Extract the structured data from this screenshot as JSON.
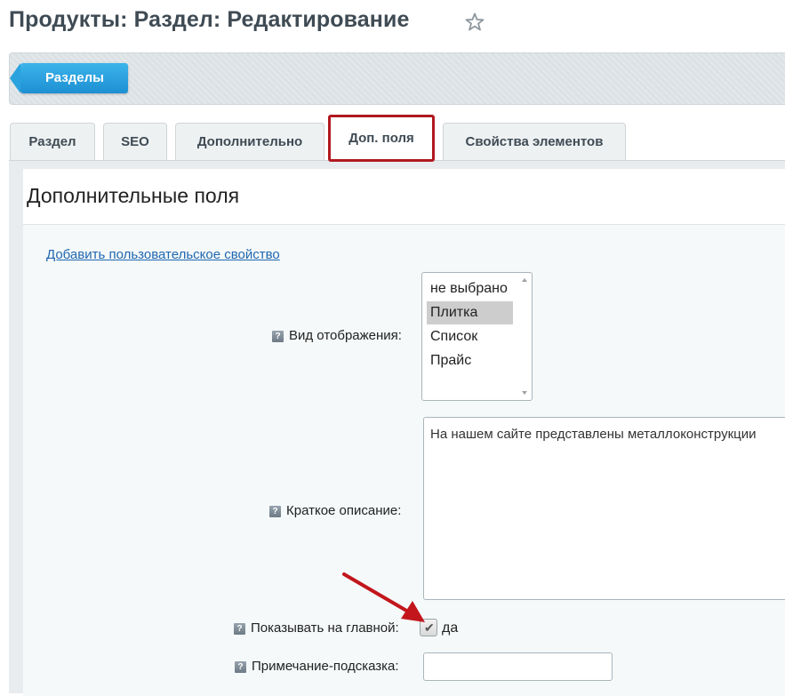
{
  "header": {
    "title": "Продукты: Раздел: Редактирование",
    "favorite_icon": "star-icon"
  },
  "toolbar": {
    "back_label": "Разделы"
  },
  "tabs": [
    {
      "label": "Раздел"
    },
    {
      "label": "SEO"
    },
    {
      "label": "Дополнительно"
    },
    {
      "label": "Доп. поля",
      "active": true
    },
    {
      "label": "Свойства элементов"
    }
  ],
  "section": {
    "title": "Дополнительные поля",
    "add_link": "Добавить пользовательское свойство"
  },
  "fields": {
    "display_type": {
      "label": "Вид отображения:",
      "options": [
        "не выбрано",
        "Плитка",
        "Список",
        "Прайс"
      ],
      "selected": "Плитка"
    },
    "short_description": {
      "label": "Краткое описание:",
      "value": "На нашем сайте представлены металлоконструкции"
    },
    "show_on_main": {
      "label": "Показывать на главной:",
      "checked": true,
      "checkbox_label": "да"
    },
    "hint_note": {
      "label": "Примечание-подсказка:",
      "value": ""
    }
  },
  "help_icon_glyph": "?",
  "colors": {
    "accent": "#1d8fd3",
    "highlight_border": "#b0191e",
    "arrow": "#c2161c"
  }
}
